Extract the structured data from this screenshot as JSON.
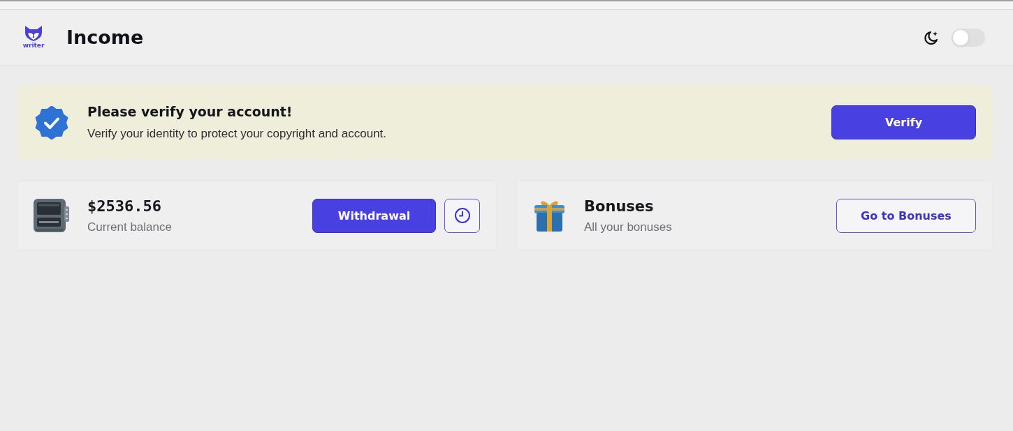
{
  "header": {
    "logo_text": "writer",
    "title": "Income",
    "dark_mode_toggle": {
      "on": false
    }
  },
  "verify_banner": {
    "title": "Please verify your account!",
    "message": "Verify your identity to protect your copyright and account.",
    "button": "Verify"
  },
  "cards": [
    {
      "kind": "balance",
      "value": "$2536.56",
      "caption": "Current balance",
      "button": "Withdrawal"
    },
    {
      "kind": "bonuses",
      "value": "Bonuses",
      "caption": "All your bonuses",
      "button": "Go to Bonuses"
    }
  ]
}
